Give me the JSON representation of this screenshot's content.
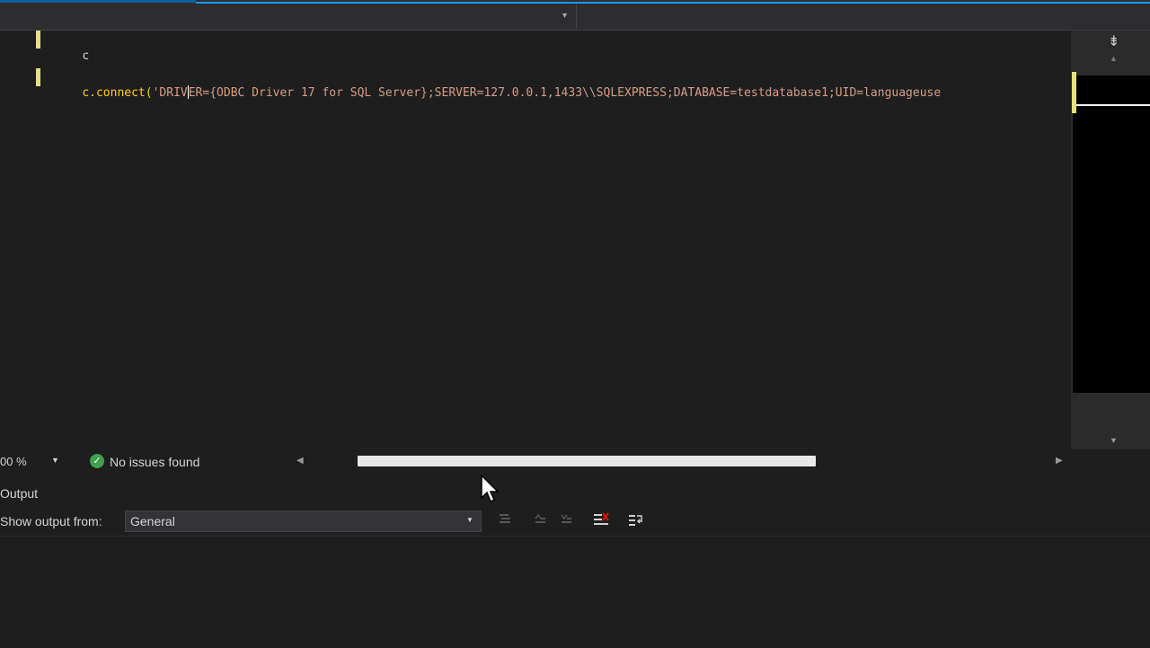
{
  "editor": {
    "lines": [
      {
        "text": "c"
      },
      {
        "prefix": "c.connect(",
        "string_part1": "'DRIV",
        "string_part2": "ER={ODBC Driver 17 for SQL Server};SERVER=127.0.0.1,1433\\\\SQLEXPRESS;DATABASE=testdatabase1;UID=languageuse"
      }
    ]
  },
  "minimap": {
    "split_icon": "⇟",
    "up_arrow": "▲",
    "down_arrow": "▼"
  },
  "statusbar": {
    "zoom": "00 %",
    "zoom_arrow": "▼",
    "issues_icon": "✓",
    "issues_label": "No issues found",
    "scroll_left": "◀",
    "scroll_right": "▶"
  },
  "output": {
    "title": "Output",
    "show_label": "Show output from:",
    "source_value": "General",
    "source_arrow": "▼",
    "tool_icons": [
      "find-previous-icon",
      "go-to-previous-icon",
      "go-to-next-icon",
      "clear-all-icon",
      "word-wrap-icon"
    ]
  },
  "colors": {
    "accent": "#1c97ea",
    "change_marker": "#e8e07a",
    "string": "#d69d85",
    "success": "#3fa14c"
  }
}
